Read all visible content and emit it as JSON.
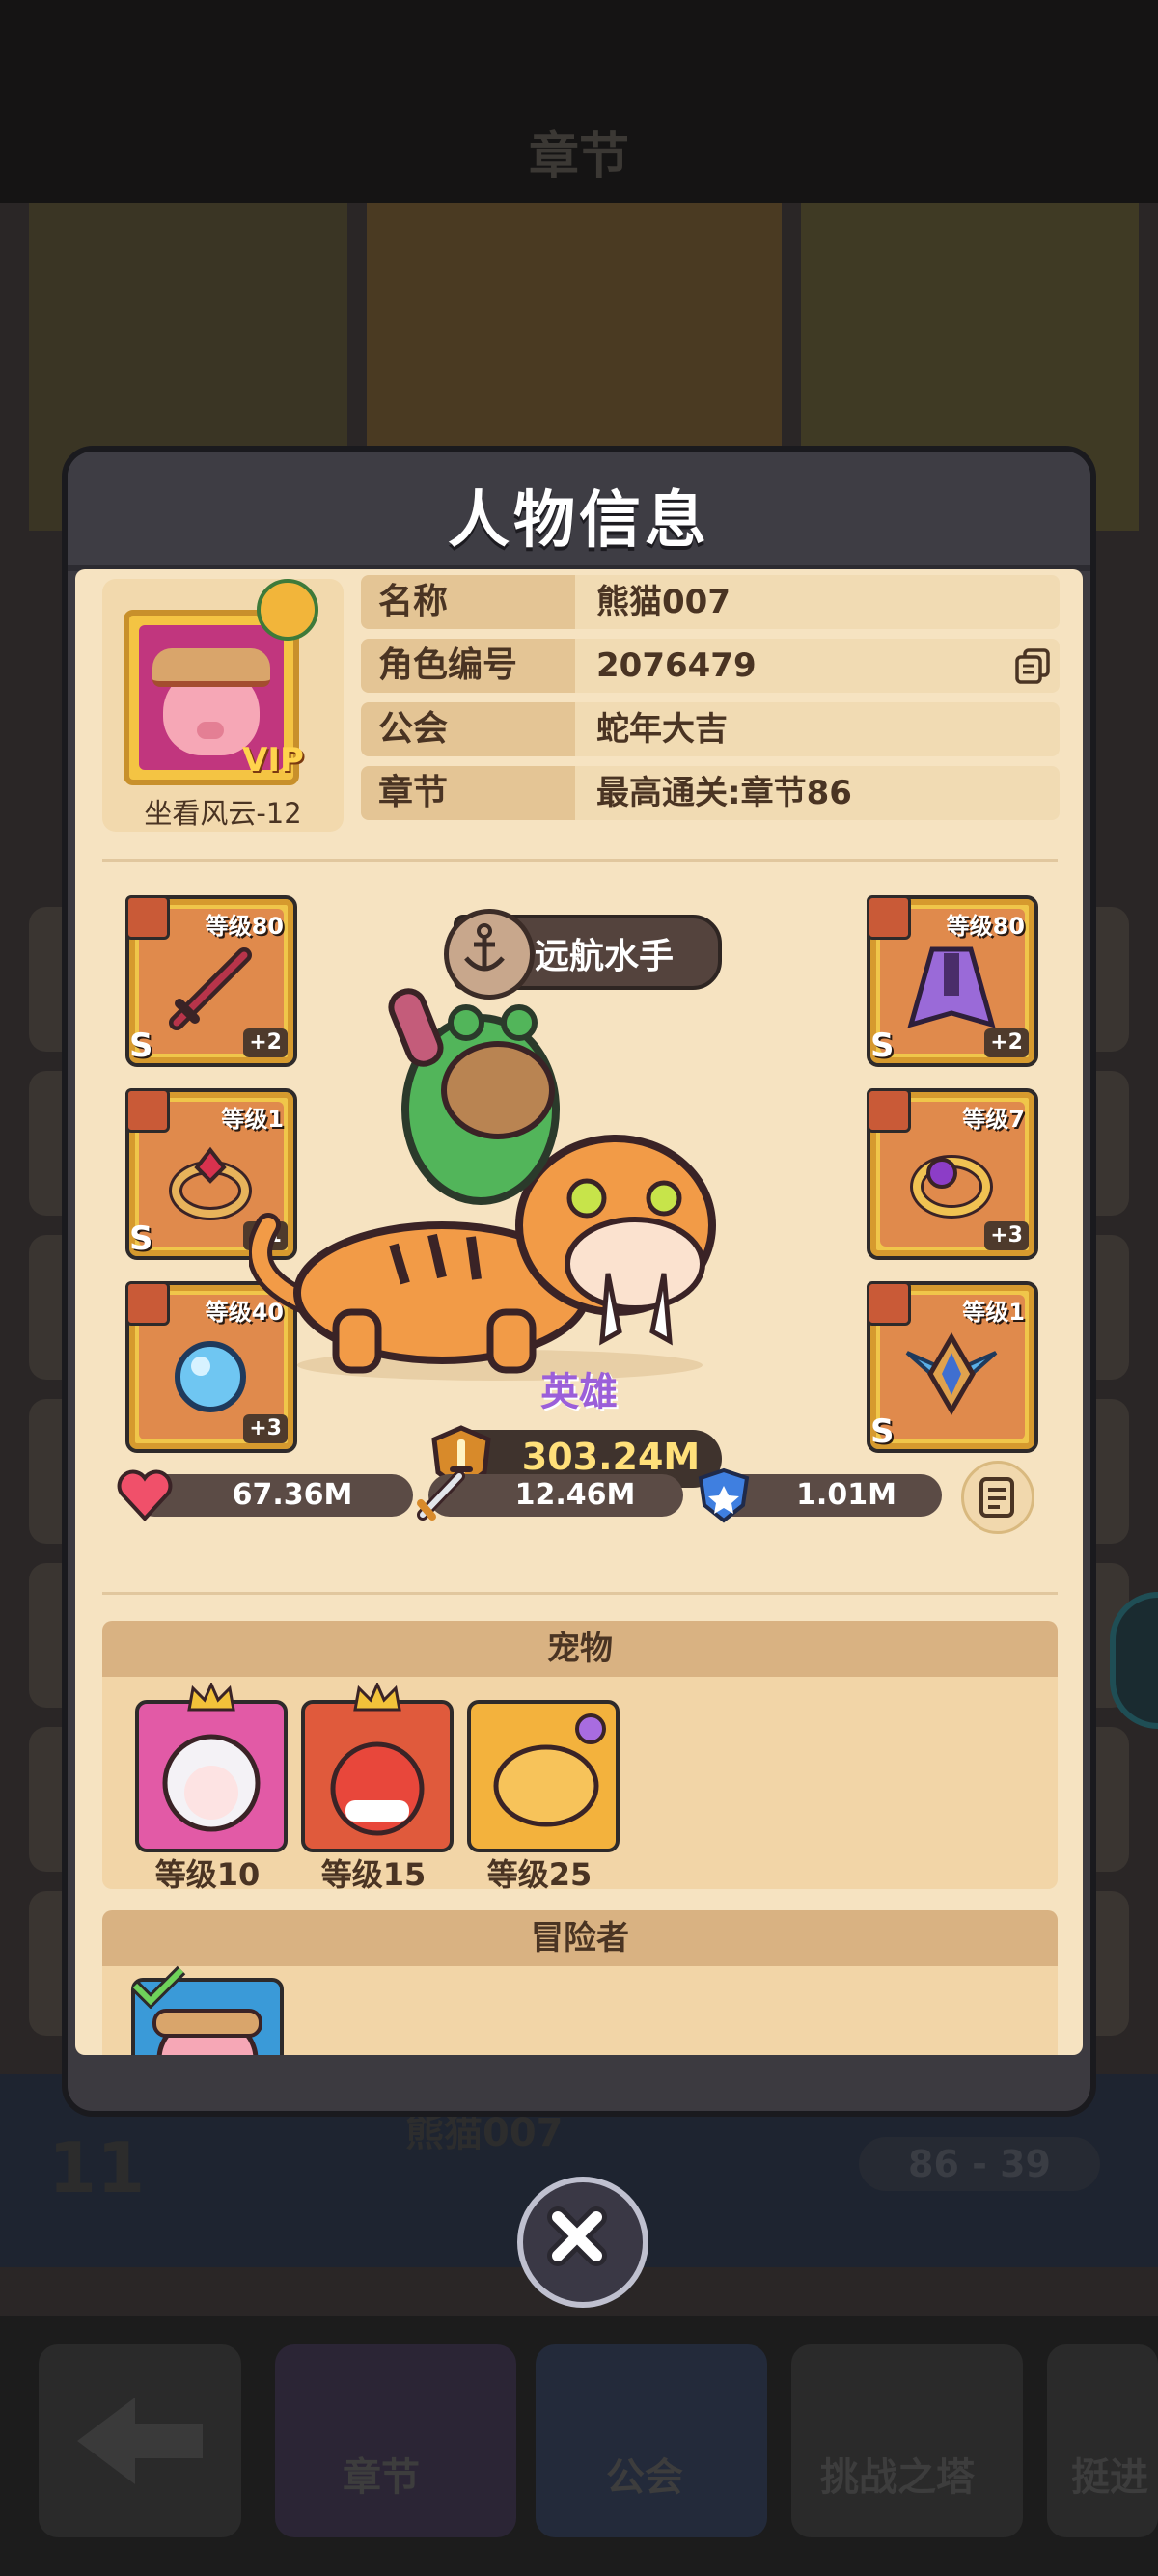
{
  "background": {
    "screen_title": "章节",
    "rank_number": "11",
    "player_name": "熊猫007",
    "score": "86 - 39",
    "nav": [
      "章节",
      "公会",
      "挑战之塔",
      "挺进"
    ]
  },
  "dialog": {
    "title": "人物信息",
    "avatar_caption": "坐看风云-12",
    "avatar_badge": "VIP",
    "info": [
      {
        "label": "名称",
        "value": "熊猫007"
      },
      {
        "label": "角色编号",
        "value": "2076479"
      },
      {
        "label": "公会",
        "value": "蛇年大吉"
      },
      {
        "label": "章节",
        "value": "最高通关:章节86"
      }
    ],
    "equipment": {
      "weapon": {
        "level": "等级80",
        "rank": "S",
        "plus": "+2",
        "icon": "sword-icon"
      },
      "armor": {
        "level": "等级80",
        "rank": "S",
        "plus": "+2",
        "icon": "cape-icon"
      },
      "ring_left": {
        "level": "等级1",
        "rank": "S",
        "plus": "+1",
        "icon": "ring-icon"
      },
      "ring_right": {
        "level": "等级7",
        "rank": "",
        "plus": "+3",
        "icon": "ring-icon"
      },
      "necklace": {
        "level": "等级40",
        "rank": "",
        "plus": "+3",
        "icon": "orb-icon"
      },
      "emblem": {
        "level": "等级1",
        "rank": "S",
        "plus": "",
        "icon": "wing-emblem-icon"
      }
    },
    "title_badge": "远航水手",
    "hero_rarity": "英雄",
    "power": "303.24M",
    "stats": {
      "hp": "67.36M",
      "attack": "12.46M",
      "defense": "1.01M"
    },
    "pets_section": "宠物",
    "pets": [
      {
        "level": "等级10",
        "color": "#e25aa6"
      },
      {
        "level": "等级15",
        "color": "#e05a3c"
      },
      {
        "level": "等级25",
        "color": "#f3b23d"
      }
    ],
    "adventurers_section": "冒险者"
  },
  "colors": {
    "accent_text": "#4a3423",
    "hero_purple": "#9b5fd9",
    "power_gold": "#ffe07a"
  }
}
